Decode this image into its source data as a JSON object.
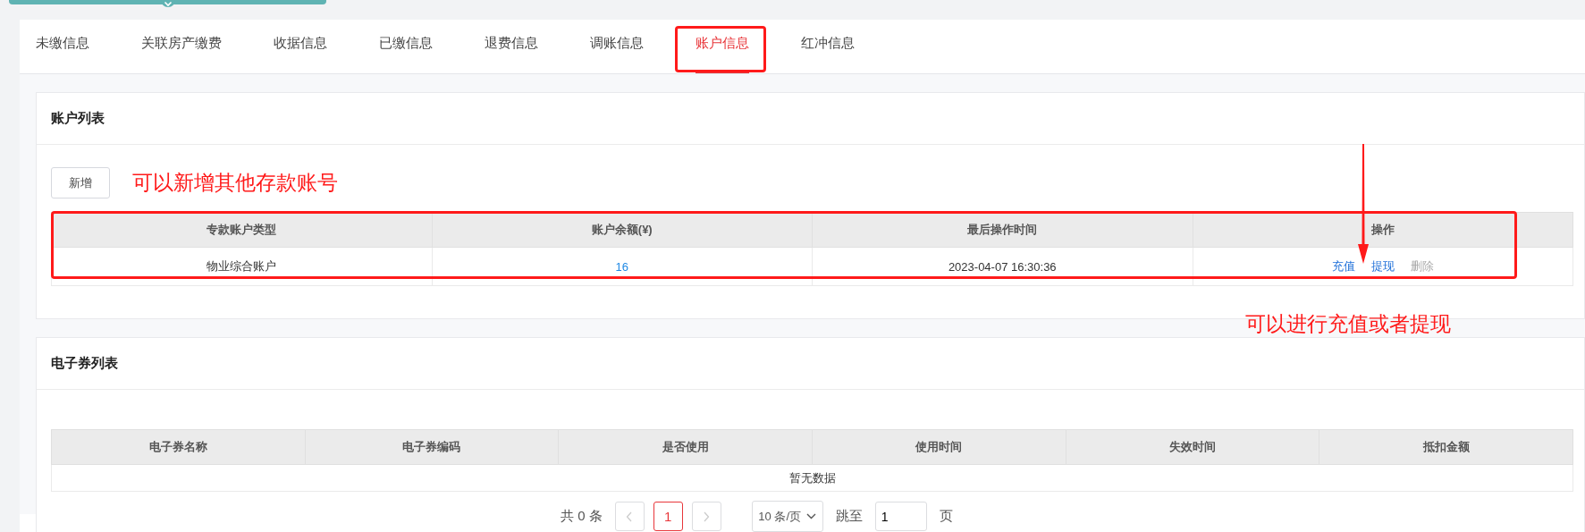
{
  "tabs": [
    {
      "label": "未缴信息",
      "selected": false,
      "highlighted": false
    },
    {
      "label": "关联房产缴费",
      "selected": false,
      "highlighted": false
    },
    {
      "label": "收据信息",
      "selected": false,
      "highlighted": false
    },
    {
      "label": "已缴信息",
      "selected": false,
      "highlighted": false
    },
    {
      "label": "退费信息",
      "selected": false,
      "highlighted": false
    },
    {
      "label": "调账信息",
      "selected": false,
      "highlighted": false
    },
    {
      "label": "账户信息",
      "selected": true,
      "highlighted": true
    },
    {
      "label": "红冲信息",
      "selected": false,
      "highlighted": false
    }
  ],
  "account_list": {
    "title": "账户列表",
    "add_button": "新增",
    "add_note": "可以新增其他存款账号",
    "highlighted": true,
    "columns": [
      "专款账户类型",
      "账户余额(¥)",
      "最后操作时间",
      "操作"
    ],
    "rows": [
      {
        "type": "物业综合账户",
        "balance": "16",
        "last_time": "2023-04-07 16:30:36",
        "actions": [
          {
            "label": "充值",
            "disabled": false
          },
          {
            "label": "提现",
            "disabled": false
          },
          {
            "label": "删除",
            "disabled": true
          }
        ]
      }
    ],
    "action_note": "可以进行充值或者提现"
  },
  "voucher_list": {
    "title": "电子券列表",
    "columns": [
      "电子券名称",
      "电子券编码",
      "是否使用",
      "使用时间",
      "失效时间",
      "抵扣金额"
    ],
    "empty_text": "暂无数据",
    "pagination": {
      "total": "共 0 条",
      "prev_disabled": true,
      "pages": [
        {
          "label": "1",
          "selected": true
        }
      ],
      "next_disabled": true,
      "page_size": "10 条/页",
      "jump_label": "跳至",
      "jump_value": "1",
      "page_unit": "页"
    }
  }
}
